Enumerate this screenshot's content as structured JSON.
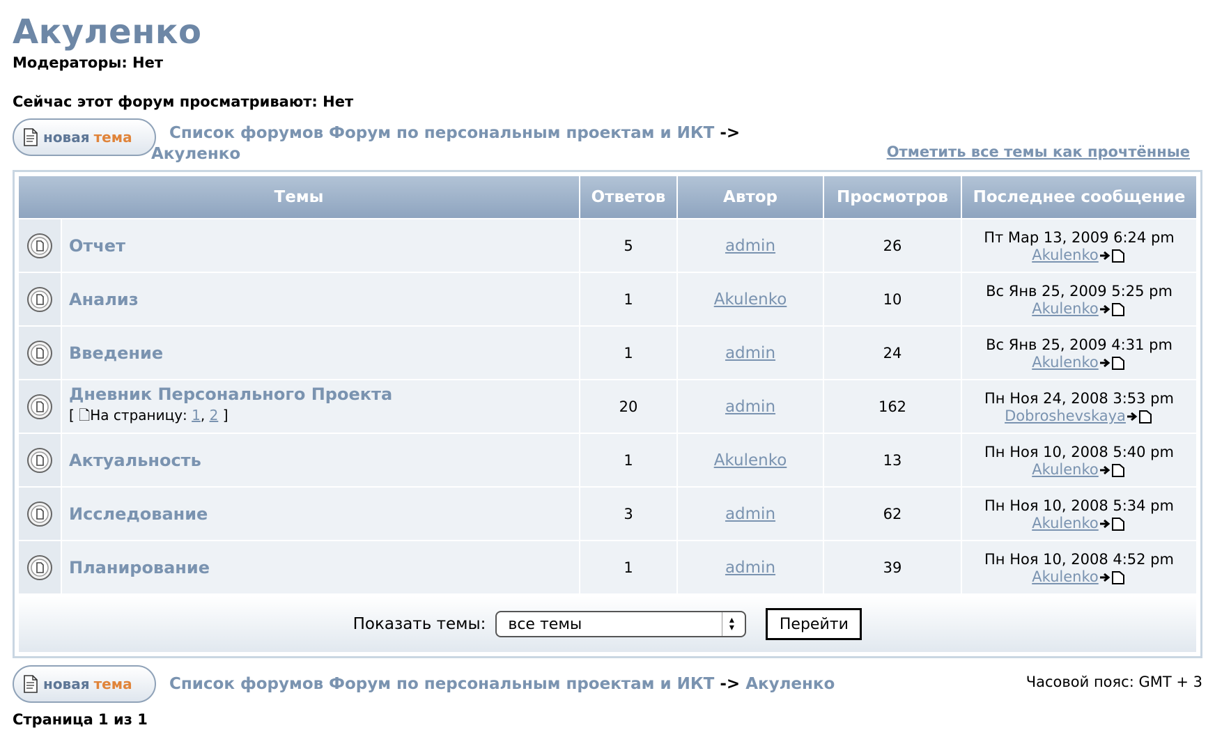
{
  "forum": {
    "title": "Акуленко",
    "moderators": "Модераторы: Нет",
    "viewers": "Сейчас этот форум просматривают: Нет",
    "mark_read": "Отметить все темы как прочтённые",
    "timezone": "Часовой пояс: GMT + 3",
    "pagination": "Страница 1 из 1"
  },
  "new_topic_button": {
    "word1": "новая",
    "word2": "тема"
  },
  "breadcrumb": {
    "root": "Список форумов Форум по персональным проектам и ИКТ",
    "separator": "->",
    "current": "Акуленко"
  },
  "table": {
    "headers": [
      "Темы",
      "Ответов",
      "Автор",
      "Просмотров",
      "Последнее сообщение"
    ],
    "rows": [
      {
        "title": "Отчет",
        "replies": "5",
        "author": "admin",
        "views": "26",
        "last_date": "Пт Мар 13, 2009 6:24 pm",
        "last_user": "Akulenko"
      },
      {
        "title": "Анализ",
        "replies": "1",
        "author": "Akulenko",
        "views": "10",
        "last_date": "Вс Янв 25, 2009 5:25 pm",
        "last_user": "Akulenko"
      },
      {
        "title": "Введение",
        "replies": "1",
        "author": "admin",
        "views": "24",
        "last_date": "Вс Янв 25, 2009 4:31 pm",
        "last_user": "Akulenko"
      },
      {
        "title": "Дневник Персонального Проекта",
        "replies": "20",
        "author": "admin",
        "views": "162",
        "last_date": "Пн Ноя 24, 2008 3:53 pm",
        "last_user": "Dobroshevskaya",
        "pages_prefix": "[",
        "pages_label": "На страницу:",
        "page1": "1",
        "page_sep": ",",
        "page2": "2",
        "pages_suffix": "]"
      },
      {
        "title": "Актуальность",
        "replies": "1",
        "author": "Akulenko",
        "views": "13",
        "last_date": "Пн Ноя 10, 2008 5:40 pm",
        "last_user": "Akulenko"
      },
      {
        "title": "Исследование",
        "replies": "3",
        "author": "admin",
        "views": "62",
        "last_date": "Пн Ноя 10, 2008 5:34 pm",
        "last_user": "Akulenko"
      },
      {
        "title": "Планирование",
        "replies": "1",
        "author": "admin",
        "views": "39",
        "last_date": "Пн Ноя 10, 2008 4:52 pm",
        "last_user": "Akulenko"
      }
    ]
  },
  "filter": {
    "label": "Показать темы:",
    "selected": "все темы",
    "go_button": "Перейти"
  }
}
